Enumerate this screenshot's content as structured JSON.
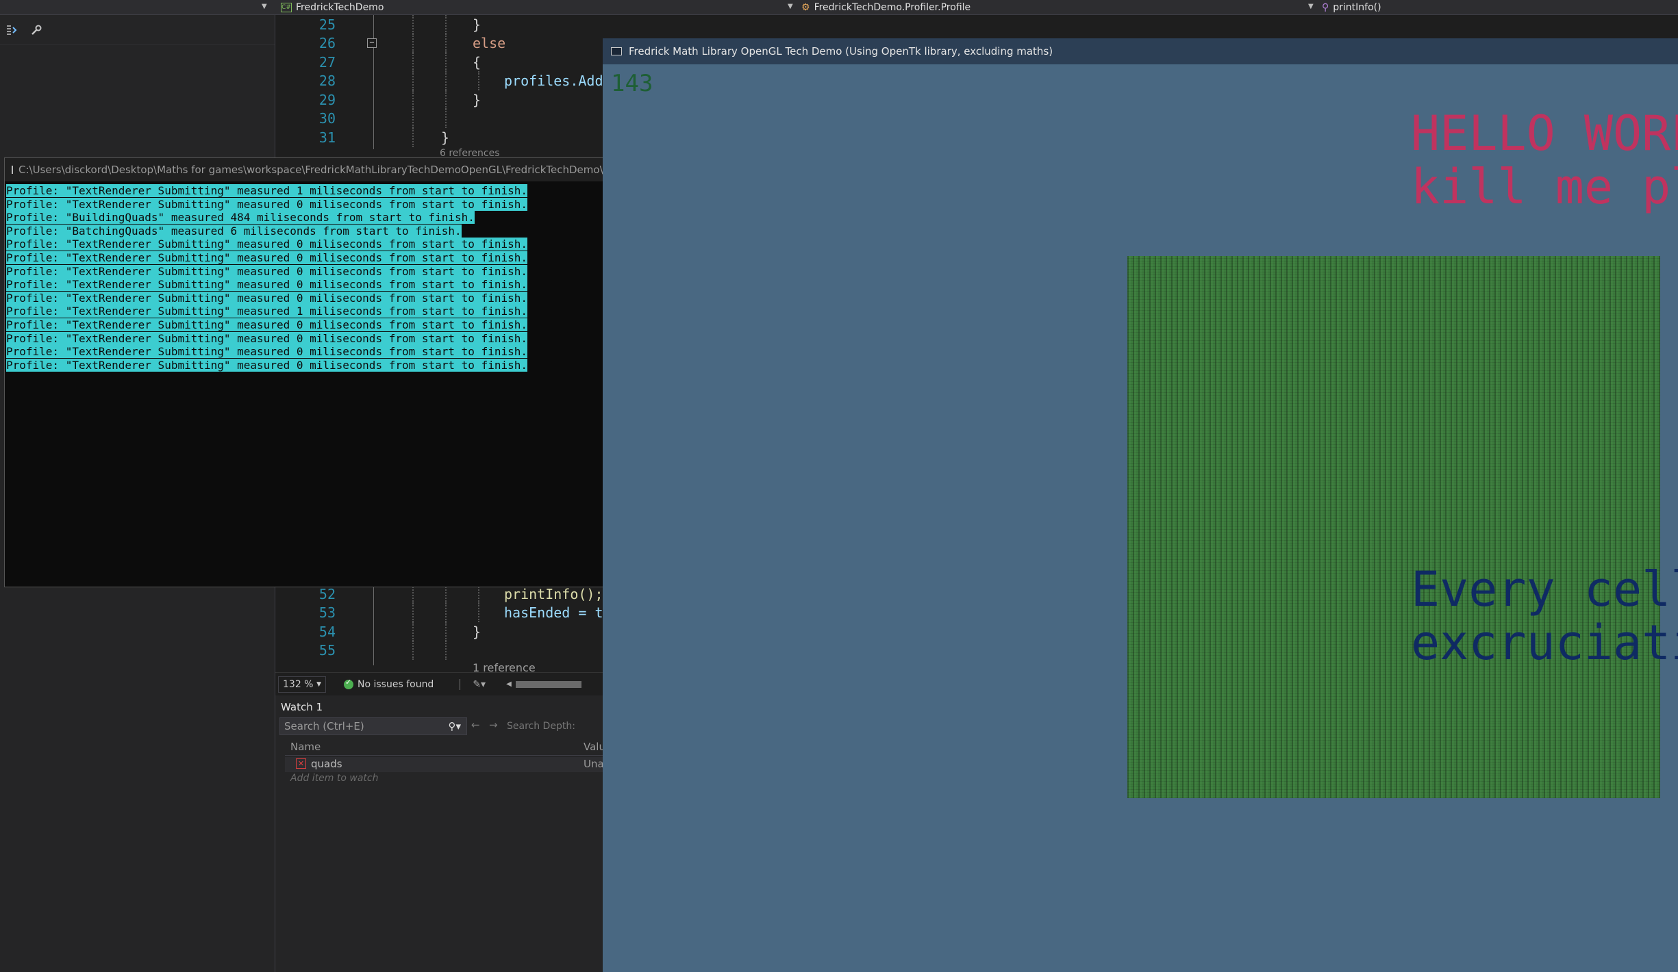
{
  "navbar": {
    "project": "FredrickTechDemo",
    "type": "FredrickTechDemo.Profiler.Profile",
    "member": "printInfo()"
  },
  "editor": {
    "top_lines": [
      {
        "num": "25",
        "text": "}"
      },
      {
        "num": "26",
        "text": "else"
      },
      {
        "num": "27",
        "text": "{"
      },
      {
        "num": "28",
        "text": "profiles.Add("
      },
      {
        "num": "29",
        "text": "}"
      },
      {
        "num": "30",
        "text": ""
      },
      {
        "num": "31",
        "text": "}"
      }
    ],
    "bottom_lines": [
      {
        "num": "52",
        "text": "printInfo();"
      },
      {
        "num": "53",
        "text": "hasEnded = tr"
      },
      {
        "num": "54",
        "text": "}"
      },
      {
        "num": "55",
        "text": ""
      }
    ],
    "references_partial": "6 references",
    "reference_count": "1 reference"
  },
  "statusbar": {
    "zoom": "132 %",
    "issues": "No issues found"
  },
  "watch": {
    "title": "Watch 1",
    "search_placeholder": "Search (Ctrl+E)",
    "search_depth": "Search Depth:",
    "col_name": "Name",
    "col_value": "Valu",
    "items": [
      {
        "name": "quads",
        "value": "Una"
      }
    ],
    "add_placeholder": "Add item to watch"
  },
  "console": {
    "title": "C:\\Users\\disckord\\Desktop\\Maths for games\\workspace\\FredrickMathLibraryTechDemoOpenGL\\FredrickTechDemo\\bin\\Debug",
    "lines": [
      "Profile: \"TextRenderer Submitting\" measured 1 miliseconds from start to finish.",
      "Profile: \"TextRenderer Submitting\" measured 0 miliseconds from start to finish.",
      "Profile: \"BuildingQuads\" measured 484 miliseconds from start to finish.",
      "Profile: \"BatchingQuads\" measured 6 miliseconds from start to finish.",
      "Profile: \"TextRenderer Submitting\" measured 0 miliseconds from start to finish.",
      "Profile: \"TextRenderer Submitting\" measured 0 miliseconds from start to finish.",
      "Profile: \"TextRenderer Submitting\" measured 0 miliseconds from start to finish.",
      "Profile: \"TextRenderer Submitting\" measured 0 miliseconds from start to finish.",
      "Profile: \"TextRenderer Submitting\" measured 0 miliseconds from start to finish.",
      "Profile: \"TextRenderer Submitting\" measured 1 miliseconds from start to finish.",
      "Profile: \"TextRenderer Submitting\" measured 0 miliseconds from start to finish.",
      "Profile: \"TextRenderer Submitting\" measured 0 miliseconds from start to finish.",
      "Profile: \"TextRenderer Submitting\" measured 0 miliseconds from start to finish.",
      "Profile: \"TextRenderer Submitting\" measured 0 miliseconds from start to finish."
    ]
  },
  "glwindow": {
    "title": "Fredrick Math Library OpenGL Tech Demo (Using OpenTk library, excluding maths)",
    "fps": "143",
    "hello_line1": "HELLO WORL",
    "hello_line2": "kill me pl",
    "info_line1": "Every cell",
    "info_line2": "excruciati"
  },
  "colors": {
    "gl_background": "#496882",
    "console_highlight": "#3ccdd0",
    "grid_green": "#3b7a3c",
    "hello_text": "#c0335f",
    "info_text": "#0f2a63"
  }
}
